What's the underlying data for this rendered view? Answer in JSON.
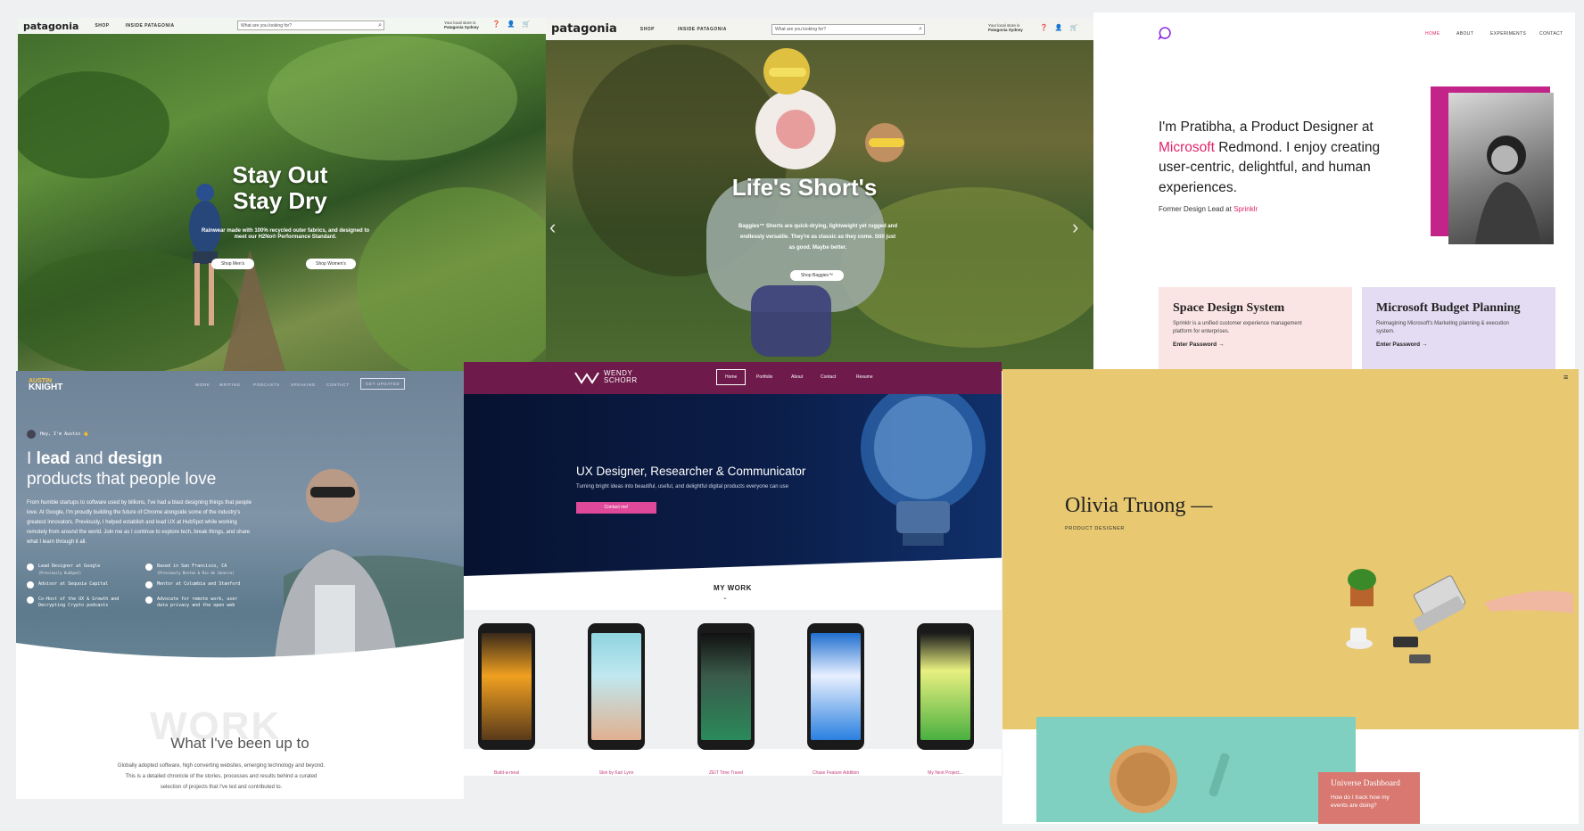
{
  "patagonia_a": {
    "logo": "patagonia",
    "nav": [
      "SHOP",
      "INSIDE PATAGONIA"
    ],
    "search_placeholder": "What are you looking for?",
    "store_line1": "Your local store is",
    "store_line2": "Patagonia Sydney",
    "headline": "Stay Out\nStay Dry",
    "subtext": "Rainwear made with 100% recycled outer fabrics, and designed to meet our H2No® Performance Standard.",
    "buttons": [
      "Shop Men's",
      "Shop Women's"
    ]
  },
  "patagonia_b": {
    "logo": "patagonia",
    "nav": [
      "SHOP",
      "INSIDE PATAGONIA"
    ],
    "search_placeholder": "What are you looking for?",
    "store_line1": "Your local store is",
    "store_line2": "Patagonia Sydney",
    "headline": "Life's Short's",
    "subtext": "Baggies™ Shorts are quick-drying, lightweight yet rugged and endlessly versatile. They're as classic as they come. Still just as good. Maybe better.",
    "button": "Shop Baggies™"
  },
  "pratibha": {
    "nav": [
      "HOME",
      "ABOUT",
      "EXPERIMENTS",
      "CONTACT"
    ],
    "intro_1": "I'm Pratibha, a Product Designer at",
    "intro_highlight": "Microsoft",
    "intro_2": "Redmond. I enjoy creating user-centric, delightful, and human experiences.",
    "former_prefix": "Former Design Lead at",
    "former_company": "Sprinklr",
    "cards": [
      {
        "title": "Space Design System",
        "desc": "Sprinklr is a unified customer experience management platform for enterprises.",
        "cta": "Enter Password"
      },
      {
        "title": "Microsoft Budget Planning",
        "desc": "Reimagining Microsoft's Marketing planning & execution system.",
        "cta": "Enter Password"
      }
    ],
    "accent": "#e0246a"
  },
  "austin": {
    "logo_line1": "AUSTIN",
    "logo_line2": "KNIGHT",
    "nav": [
      "WORK",
      "WRITING",
      "PODCASTS",
      "SPEAKING",
      "CONTACT"
    ],
    "nav_button": "GET UPDATED",
    "greeting": "Hey, I'm Austin 👋",
    "headline_1_pre": "I ",
    "headline_1_b1": "lead",
    "headline_1_mid": " and ",
    "headline_1_b2": "design",
    "headline_2": "products that people love",
    "paragraph": "From humble startups to software used by billions, I've had a blast designing things that people love. At Google, I'm proudly building the future of Chrome alongside some of the industry's greatest innovators. Previously, I helped establish and lead UX at HubSpot while working remotely from around the world. Join me as I continue to explore tech, break things, and share what I learn through it all.",
    "bullets": [
      {
        "line1": "Lead Designer at Google",
        "line2": "(Previously HubSpot)"
      },
      {
        "line1": "Based in San Francisco, CA",
        "line2": "(Previously Boston & Rio de Janeiro)"
      },
      {
        "line1": "Advisor at Sequoia Capital",
        "line2": ""
      },
      {
        "line1": "Mentor at Columbia and Stanford",
        "line2": ""
      },
      {
        "line1": "Co-Host of the UX & Growth and",
        "line2": "Decrypting Crypto podcasts"
      },
      {
        "line1": "Advocate for remote work, user",
        "line2": "data privacy and the open web"
      }
    ],
    "work_watermark": "WORK",
    "work_title": "What I've been up to",
    "work_desc": "Globally adopted software, high converting websites, emerging technology and beyond. This is a detailed chronicle of the stories, processes and results behind a curated selection of projects that I've led and contributed to."
  },
  "wendy": {
    "logo_line1": "WENDY",
    "logo_line2": "SCHORR",
    "nav": [
      "Home",
      "Portfolio",
      "About",
      "Contact",
      "Resume"
    ],
    "hero_title": "UX Designer, Researcher & Communicator",
    "hero_sub": "Turning bright ideas into beautiful, useful, and delightful digital products everyone can use",
    "hero_button": "Contact me!",
    "section_title": "MY WORK",
    "phones": [
      "Build-a-meal",
      "Skin by Kari Lynn",
      "ZEIT Time Travel",
      "Chase Feature Addition",
      "My Next Project..."
    ],
    "primary": "#6e1a4a",
    "accent": "#e0489a"
  },
  "olivia": {
    "name": "Olivia Truong —",
    "role": "PRODUCT DESIGNER",
    "menu_icon": "hamburger-icon",
    "card_title": "Universe Dashboard",
    "card_sub": "How do I track how my events are doing?",
    "bg": "#e8c870"
  }
}
